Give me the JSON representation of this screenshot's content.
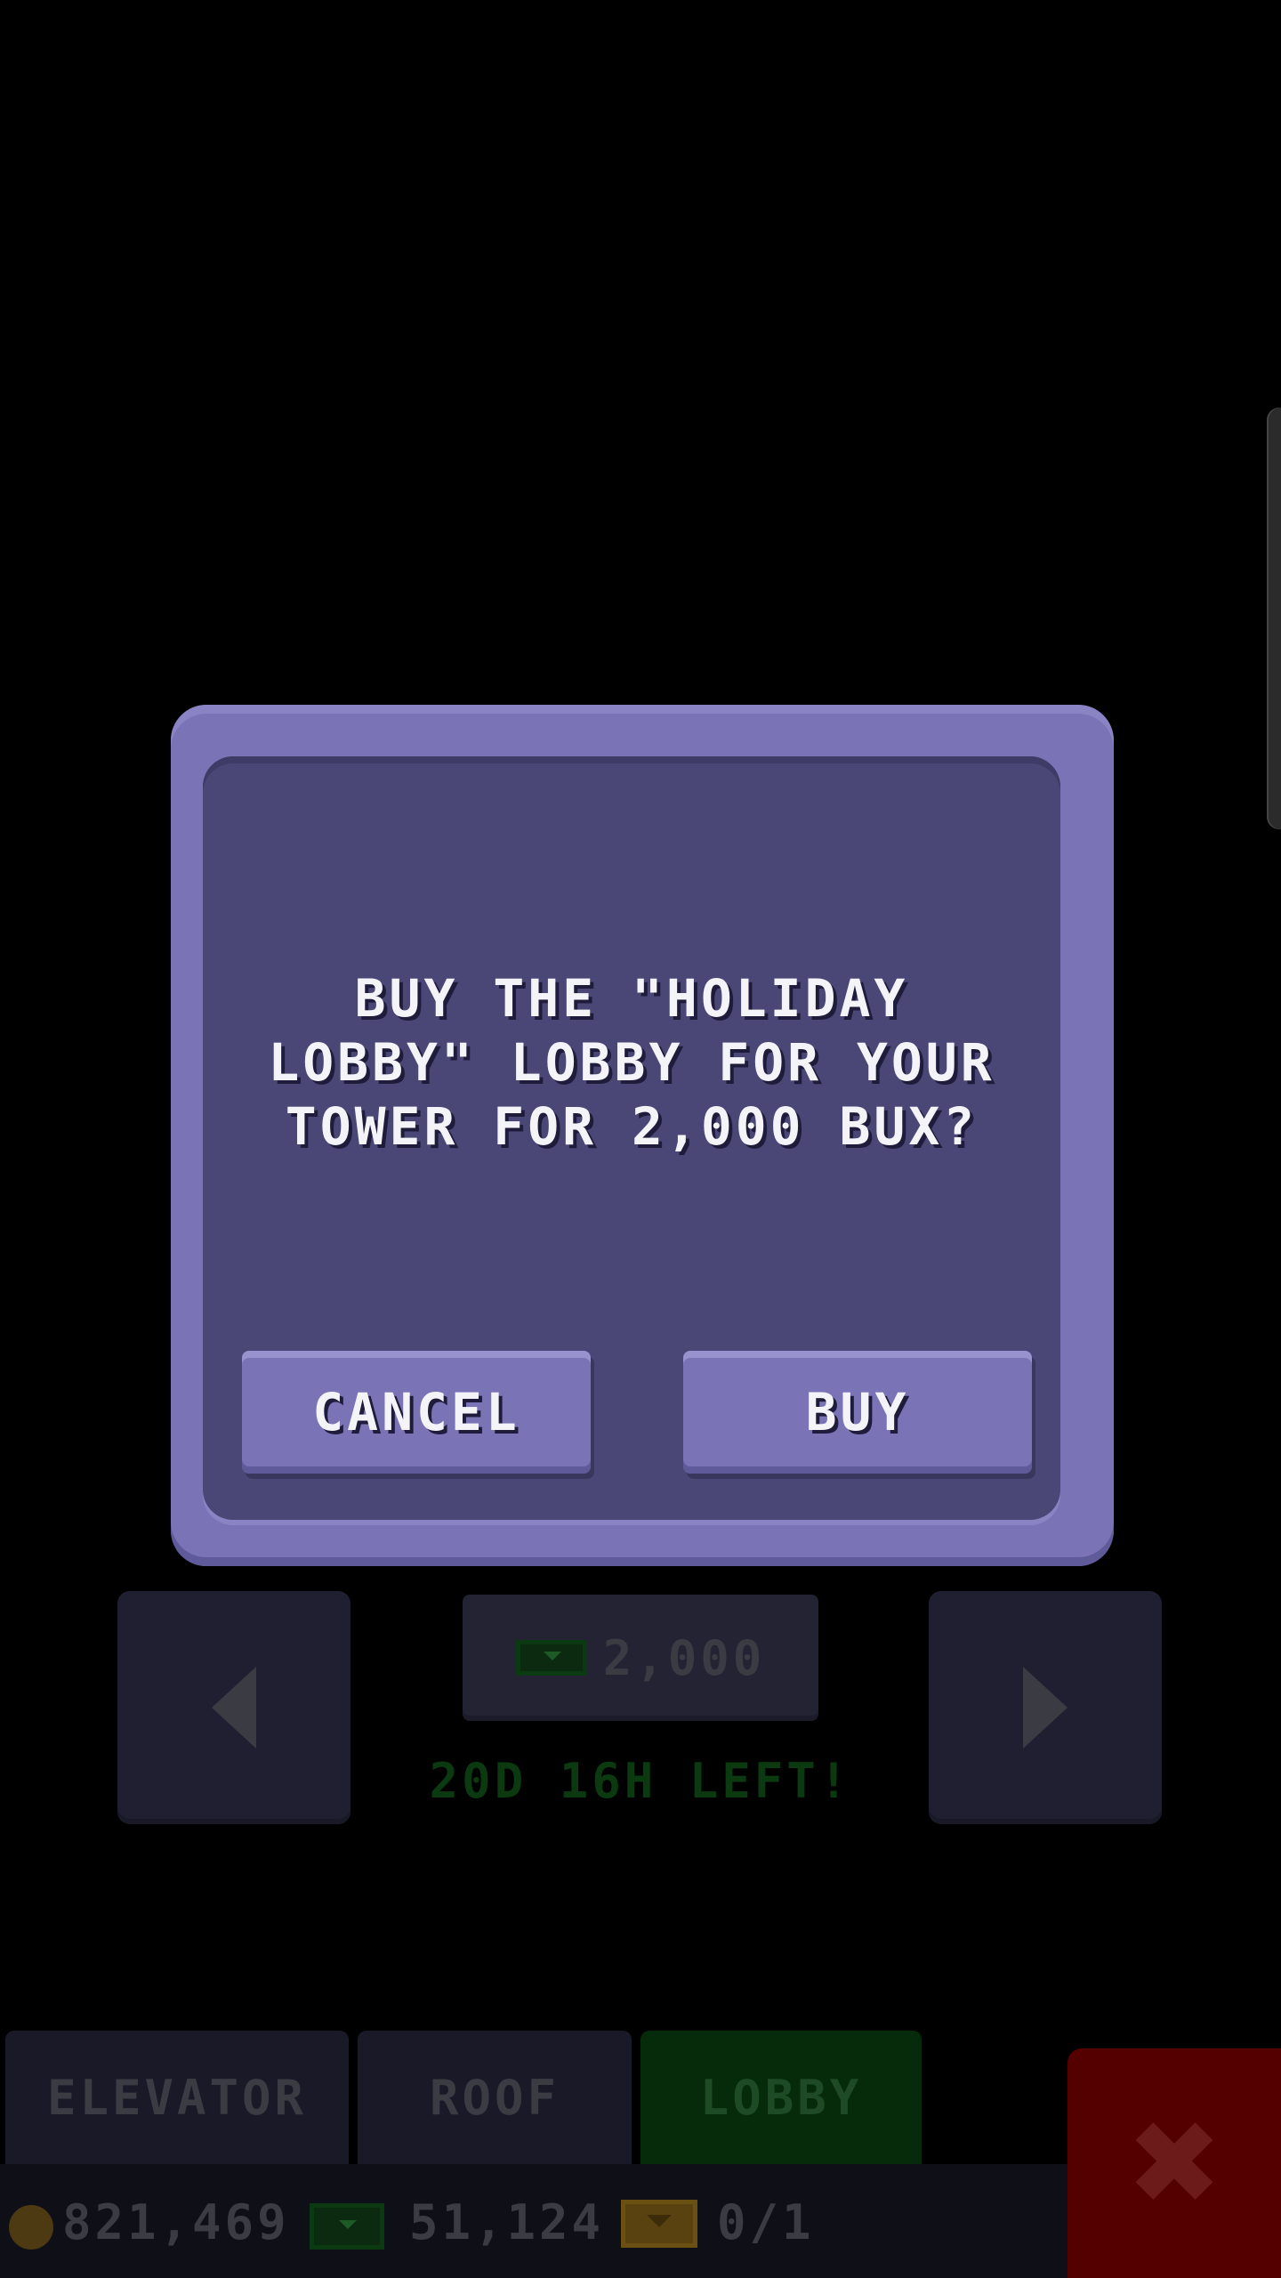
{
  "dialog": {
    "message": "BUY THE \"HOLIDAY LOBBY\" LOBBY FOR YOUR TOWER FOR 2,000 BUX?",
    "cancel_label": "CANCEL",
    "buy_label": "BUY"
  },
  "picker": {
    "price": "2,000",
    "timer": "20D 16H LEFT!"
  },
  "tabs": [
    {
      "label": "ELEVATOR",
      "active": false
    },
    {
      "label": "ROOF",
      "active": false
    },
    {
      "label": "LOBBY",
      "active": true
    }
  ],
  "status": {
    "coins": "821,469",
    "bux": "51,124",
    "tickets": "0/1"
  },
  "icons": {
    "coin": "coin-icon",
    "bux": "bux-icon",
    "ticket": "ticket-icon",
    "close": "close-icon",
    "prev": "arrow-left-icon",
    "next": "arrow-right-icon"
  },
  "colors": {
    "dialog": "#7a73b6",
    "dialog_inner": "#4a4776",
    "active_tab": "#062b0a",
    "close": "#540000"
  }
}
